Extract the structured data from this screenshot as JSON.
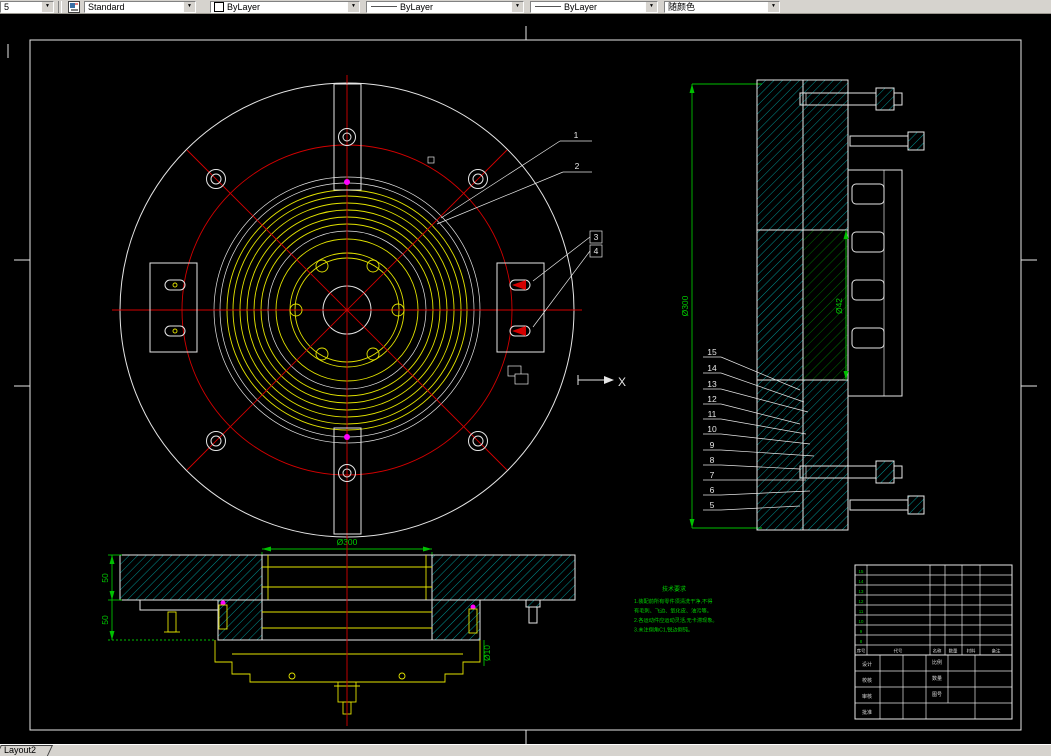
{
  "toolbar": {
    "left_combo_value": "5",
    "style_combo_value": "Standard",
    "color_combo_value": "ByLayer",
    "linetype_combo_value": "ByLayer",
    "lineweight_combo_value": "ByLayer",
    "plotstyle_combo_value": "随颜色"
  },
  "statusbar": {
    "tab_label": "Layout2"
  },
  "drawing": {
    "callouts": [
      "1",
      "2",
      "3",
      "4",
      "5",
      "6",
      "7",
      "8",
      "9",
      "10",
      "11",
      "12",
      "13",
      "14",
      "15"
    ],
    "dimensions": {
      "section_outer_dia": "Ø300",
      "section_bore_dia": "Ø42",
      "plate_dia": "Ø300",
      "upper_thickness": "50",
      "lower_thickness": "50",
      "small_hole_dia": "Ø10"
    },
    "ucs_axis_label": "X",
    "notes": {
      "title": "技术要求",
      "line1": "1.装配前所有零件须清洗干净,不得",
      "line2": "有毛刺、飞边、氧化皮、油污等。",
      "line3": "2.各运动件应运动灵活,无卡滞现象。",
      "line4": "3.未注倒角C1,锐边倒钝。"
    },
    "title_block": {
      "parts_header": [
        "序号",
        "代号",
        "名称",
        "数量",
        "材料",
        "备注"
      ],
      "row_numbers": [
        "15",
        "14",
        "13",
        "12",
        "11",
        "10",
        "9",
        "8"
      ],
      "sign_labels": [
        "设计",
        "校核",
        "审核",
        "批准"
      ],
      "info_labels": [
        "比例",
        "数量",
        "图号"
      ]
    }
  }
}
